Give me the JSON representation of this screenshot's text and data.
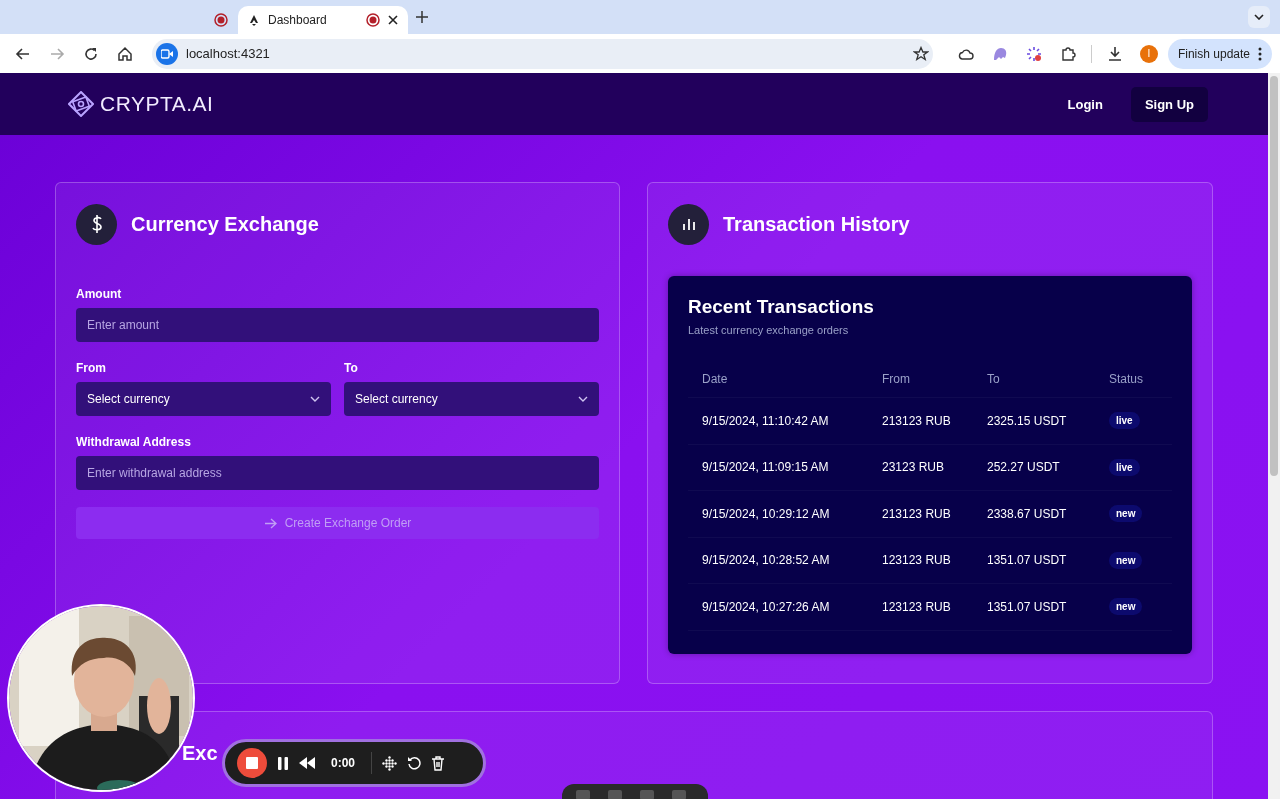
{
  "browser": {
    "tabs": [
      {
        "selected": false
      },
      {
        "label": "Dashboard",
        "selected": true
      }
    ],
    "address": "localhost:4321",
    "profile_initial": "I",
    "update_button": "Finish update"
  },
  "header": {
    "logo": "CRYPTA.AI",
    "nav": [
      {
        "label": "Login",
        "kind": "link"
      },
      {
        "label": "Sign Up",
        "kind": "button"
      }
    ]
  },
  "exchange": {
    "title": "Currency Exchange",
    "amount": {
      "label": "Amount",
      "placeholder": "Enter amount"
    },
    "from": {
      "label": "From",
      "value": "Select currency"
    },
    "to": {
      "label": "To",
      "value": "Select currency"
    },
    "address": {
      "label": "Withdrawal Address",
      "placeholder": "Enter withdrawal address"
    },
    "submit": {
      "label": "Create Exchange Order",
      "disabled": true
    }
  },
  "history": {
    "title": "Transaction History",
    "table_title": "Recent Transactions",
    "subtitle": "Latest currency exchange orders",
    "columns": [
      "Date",
      "From",
      "To",
      "Status"
    ],
    "rows": [
      {
        "date": "9/15/2024, 11:10:42 AM",
        "from": "213123 RUB",
        "to": "2325.15 USDT",
        "status": "live"
      },
      {
        "date": "9/15/2024, 11:09:15 AM",
        "from": "23123 RUB",
        "to": "252.27 USDT",
        "status": "live"
      },
      {
        "date": "9/15/2024, 10:29:12 AM",
        "from": "213123 RUB",
        "to": "2338.67 USDT",
        "status": "new"
      },
      {
        "date": "9/15/2024, 10:28:52 AM",
        "from": "123123 RUB",
        "to": "1351.07 USDT",
        "status": "new"
      },
      {
        "date": "9/15/2024, 10:27:26 AM",
        "from": "123123 RUB",
        "to": "1351.07 USDT",
        "status": "new"
      }
    ]
  },
  "third_card": {
    "title": "Exc"
  },
  "recorder": {
    "time": "0:00"
  }
}
